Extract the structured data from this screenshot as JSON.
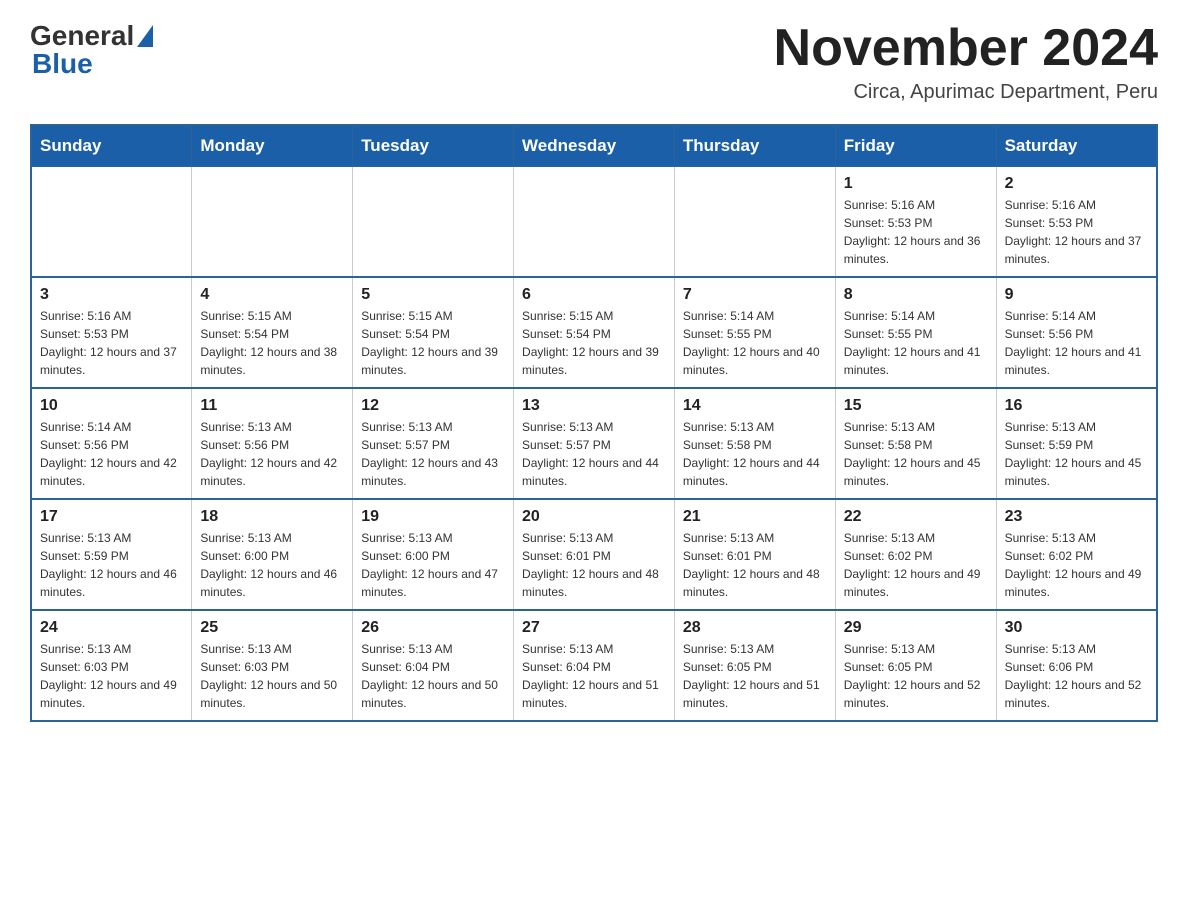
{
  "header": {
    "logo_general": "General",
    "logo_blue": "Blue",
    "month_title": "November 2024",
    "location": "Circa, Apurimac Department, Peru"
  },
  "weekdays": [
    "Sunday",
    "Monday",
    "Tuesday",
    "Wednesday",
    "Thursday",
    "Friday",
    "Saturday"
  ],
  "rows": [
    [
      {
        "day": "",
        "sunrise": "",
        "sunset": "",
        "daylight": ""
      },
      {
        "day": "",
        "sunrise": "",
        "sunset": "",
        "daylight": ""
      },
      {
        "day": "",
        "sunrise": "",
        "sunset": "",
        "daylight": ""
      },
      {
        "day": "",
        "sunrise": "",
        "sunset": "",
        "daylight": ""
      },
      {
        "day": "",
        "sunrise": "",
        "sunset": "",
        "daylight": ""
      },
      {
        "day": "1",
        "sunrise": "Sunrise: 5:16 AM",
        "sunset": "Sunset: 5:53 PM",
        "daylight": "Daylight: 12 hours and 36 minutes."
      },
      {
        "day": "2",
        "sunrise": "Sunrise: 5:16 AM",
        "sunset": "Sunset: 5:53 PM",
        "daylight": "Daylight: 12 hours and 37 minutes."
      }
    ],
    [
      {
        "day": "3",
        "sunrise": "Sunrise: 5:16 AM",
        "sunset": "Sunset: 5:53 PM",
        "daylight": "Daylight: 12 hours and 37 minutes."
      },
      {
        "day": "4",
        "sunrise": "Sunrise: 5:15 AM",
        "sunset": "Sunset: 5:54 PM",
        "daylight": "Daylight: 12 hours and 38 minutes."
      },
      {
        "day": "5",
        "sunrise": "Sunrise: 5:15 AM",
        "sunset": "Sunset: 5:54 PM",
        "daylight": "Daylight: 12 hours and 39 minutes."
      },
      {
        "day": "6",
        "sunrise": "Sunrise: 5:15 AM",
        "sunset": "Sunset: 5:54 PM",
        "daylight": "Daylight: 12 hours and 39 minutes."
      },
      {
        "day": "7",
        "sunrise": "Sunrise: 5:14 AM",
        "sunset": "Sunset: 5:55 PM",
        "daylight": "Daylight: 12 hours and 40 minutes."
      },
      {
        "day": "8",
        "sunrise": "Sunrise: 5:14 AM",
        "sunset": "Sunset: 5:55 PM",
        "daylight": "Daylight: 12 hours and 41 minutes."
      },
      {
        "day": "9",
        "sunrise": "Sunrise: 5:14 AM",
        "sunset": "Sunset: 5:56 PM",
        "daylight": "Daylight: 12 hours and 41 minutes."
      }
    ],
    [
      {
        "day": "10",
        "sunrise": "Sunrise: 5:14 AM",
        "sunset": "Sunset: 5:56 PM",
        "daylight": "Daylight: 12 hours and 42 minutes."
      },
      {
        "day": "11",
        "sunrise": "Sunrise: 5:13 AM",
        "sunset": "Sunset: 5:56 PM",
        "daylight": "Daylight: 12 hours and 42 minutes."
      },
      {
        "day": "12",
        "sunrise": "Sunrise: 5:13 AM",
        "sunset": "Sunset: 5:57 PM",
        "daylight": "Daylight: 12 hours and 43 minutes."
      },
      {
        "day": "13",
        "sunrise": "Sunrise: 5:13 AM",
        "sunset": "Sunset: 5:57 PM",
        "daylight": "Daylight: 12 hours and 44 minutes."
      },
      {
        "day": "14",
        "sunrise": "Sunrise: 5:13 AM",
        "sunset": "Sunset: 5:58 PM",
        "daylight": "Daylight: 12 hours and 44 minutes."
      },
      {
        "day": "15",
        "sunrise": "Sunrise: 5:13 AM",
        "sunset": "Sunset: 5:58 PM",
        "daylight": "Daylight: 12 hours and 45 minutes."
      },
      {
        "day": "16",
        "sunrise": "Sunrise: 5:13 AM",
        "sunset": "Sunset: 5:59 PM",
        "daylight": "Daylight: 12 hours and 45 minutes."
      }
    ],
    [
      {
        "day": "17",
        "sunrise": "Sunrise: 5:13 AM",
        "sunset": "Sunset: 5:59 PM",
        "daylight": "Daylight: 12 hours and 46 minutes."
      },
      {
        "day": "18",
        "sunrise": "Sunrise: 5:13 AM",
        "sunset": "Sunset: 6:00 PM",
        "daylight": "Daylight: 12 hours and 46 minutes."
      },
      {
        "day": "19",
        "sunrise": "Sunrise: 5:13 AM",
        "sunset": "Sunset: 6:00 PM",
        "daylight": "Daylight: 12 hours and 47 minutes."
      },
      {
        "day": "20",
        "sunrise": "Sunrise: 5:13 AM",
        "sunset": "Sunset: 6:01 PM",
        "daylight": "Daylight: 12 hours and 48 minutes."
      },
      {
        "day": "21",
        "sunrise": "Sunrise: 5:13 AM",
        "sunset": "Sunset: 6:01 PM",
        "daylight": "Daylight: 12 hours and 48 minutes."
      },
      {
        "day": "22",
        "sunrise": "Sunrise: 5:13 AM",
        "sunset": "Sunset: 6:02 PM",
        "daylight": "Daylight: 12 hours and 49 minutes."
      },
      {
        "day": "23",
        "sunrise": "Sunrise: 5:13 AM",
        "sunset": "Sunset: 6:02 PM",
        "daylight": "Daylight: 12 hours and 49 minutes."
      }
    ],
    [
      {
        "day": "24",
        "sunrise": "Sunrise: 5:13 AM",
        "sunset": "Sunset: 6:03 PM",
        "daylight": "Daylight: 12 hours and 49 minutes."
      },
      {
        "day": "25",
        "sunrise": "Sunrise: 5:13 AM",
        "sunset": "Sunset: 6:03 PM",
        "daylight": "Daylight: 12 hours and 50 minutes."
      },
      {
        "day": "26",
        "sunrise": "Sunrise: 5:13 AM",
        "sunset": "Sunset: 6:04 PM",
        "daylight": "Daylight: 12 hours and 50 minutes."
      },
      {
        "day": "27",
        "sunrise": "Sunrise: 5:13 AM",
        "sunset": "Sunset: 6:04 PM",
        "daylight": "Daylight: 12 hours and 51 minutes."
      },
      {
        "day": "28",
        "sunrise": "Sunrise: 5:13 AM",
        "sunset": "Sunset: 6:05 PM",
        "daylight": "Daylight: 12 hours and 51 minutes."
      },
      {
        "day": "29",
        "sunrise": "Sunrise: 5:13 AM",
        "sunset": "Sunset: 6:05 PM",
        "daylight": "Daylight: 12 hours and 52 minutes."
      },
      {
        "day": "30",
        "sunrise": "Sunrise: 5:13 AM",
        "sunset": "Sunset: 6:06 PM",
        "daylight": "Daylight: 12 hours and 52 minutes."
      }
    ]
  ]
}
